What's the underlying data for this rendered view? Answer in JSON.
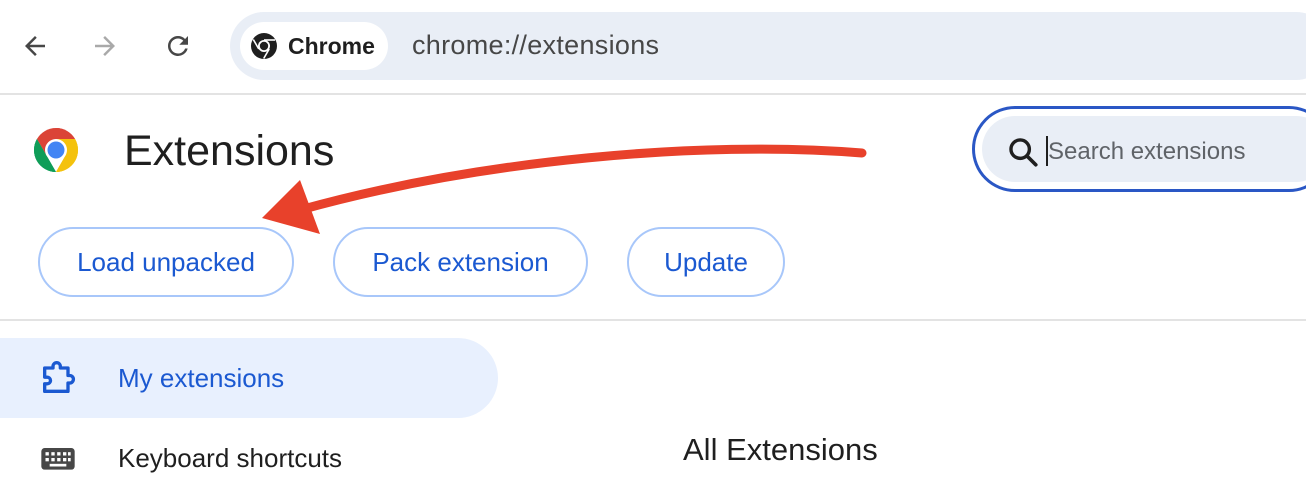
{
  "toolbar": {
    "back_icon": "arrow-left-icon",
    "forward_icon": "arrow-right-icon",
    "reload_icon": "reload-icon",
    "omnibox": {
      "chip_label": "Chrome",
      "url": "chrome://extensions"
    }
  },
  "header": {
    "title": "Extensions",
    "search": {
      "placeholder": "Search extensions",
      "value": ""
    }
  },
  "actions": {
    "load_unpacked": "Load unpacked",
    "pack_extension": "Pack extension",
    "update": "Update"
  },
  "sidebar": {
    "items": [
      {
        "label": "My extensions",
        "icon": "puzzle-icon",
        "active": true
      },
      {
        "label": "Keyboard shortcuts",
        "icon": "keyboard-icon",
        "active": false
      }
    ]
  },
  "main": {
    "section_title": "All Extensions"
  },
  "annotation": {
    "type": "arrow",
    "color": "#e8412b",
    "points_to": "load-unpacked-button"
  },
  "colors": {
    "accent": "#1b59d1",
    "button_border": "#a8c7fa",
    "active_bg": "#e8f0fe",
    "omnibox_bg": "#e9eef6",
    "search_focus": "#2a57c5"
  }
}
